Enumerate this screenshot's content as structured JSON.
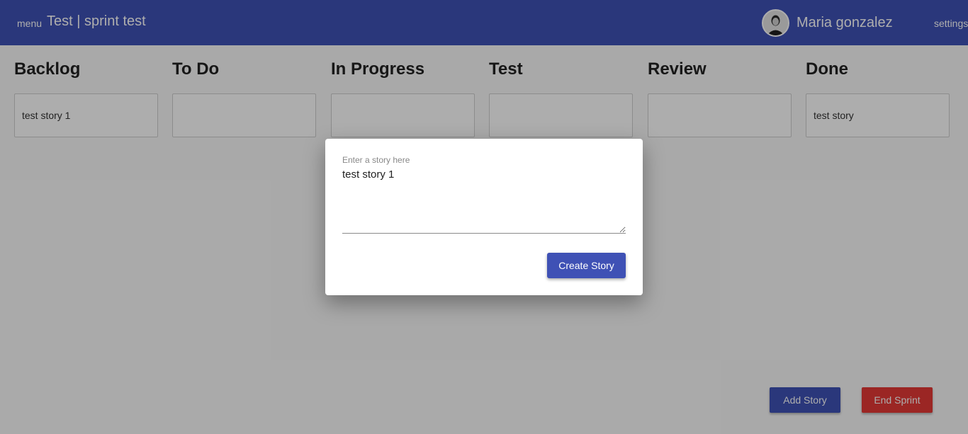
{
  "header": {
    "menu_label": "menu",
    "title": "Test | sprint test",
    "user_name": "Maria gonzalez",
    "settings_label": "settings"
  },
  "columns": [
    {
      "title": "Backlog",
      "cards": [
        "test story 1"
      ]
    },
    {
      "title": "To Do",
      "cards": [
        ""
      ]
    },
    {
      "title": "In Progress",
      "cards": [
        ""
      ]
    },
    {
      "title": "Test",
      "cards": [
        ""
      ]
    },
    {
      "title": "Review",
      "cards": [
        ""
      ]
    },
    {
      "title": "Done",
      "cards": [
        "test story"
      ]
    }
  ],
  "actions": {
    "add_story_label": "Add Story",
    "end_sprint_label": "End Sprint"
  },
  "dialog": {
    "input_label": "Enter a story here",
    "input_value": "test story 1",
    "create_label": "Create Story"
  },
  "colors": {
    "primary": "#3f51b5",
    "danger": "#e53935"
  }
}
